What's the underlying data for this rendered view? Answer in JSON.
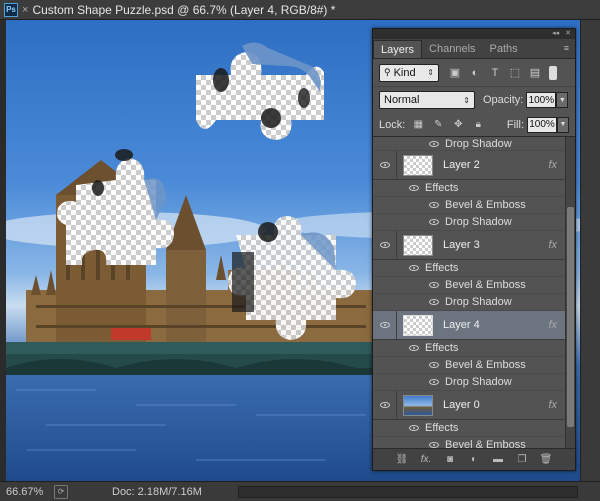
{
  "window": {
    "app_icon": "Ps",
    "close_glyph": "×",
    "title": "Custom Shape Puzzle.psd @ 66.7% (Layer 4, RGB/8#) *"
  },
  "status": {
    "zoom": "66.67%",
    "doc_info": "Doc: 2.18M/7.16M",
    "arrow": "▶"
  },
  "panel": {
    "strip_glyphs": [
      "◂◂",
      "✕"
    ],
    "tabs": [
      "Layers",
      "Channels",
      "Paths"
    ],
    "tab_menu": "≡",
    "filter": {
      "kind": "Kind"
    },
    "blend_mode": "Normal",
    "opacity_label": "Opacity:",
    "opacity_value": "100%",
    "lock_label": "Lock:",
    "fill_label": "Fill:",
    "fill_value": "100%",
    "fx_label": "fx",
    "effects_label": "Effects",
    "bevel_label": "Bevel & Emboss",
    "drop_label": "Drop Shadow",
    "layers": [
      {
        "name": "Layer 2"
      },
      {
        "name": "Layer 3"
      },
      {
        "name": "Layer 4"
      },
      {
        "name": "Layer 0"
      }
    ]
  },
  "colors": {
    "panel_bg": "#535353",
    "selected_row": "#6c7480",
    "sky": "#2e6fc3"
  }
}
